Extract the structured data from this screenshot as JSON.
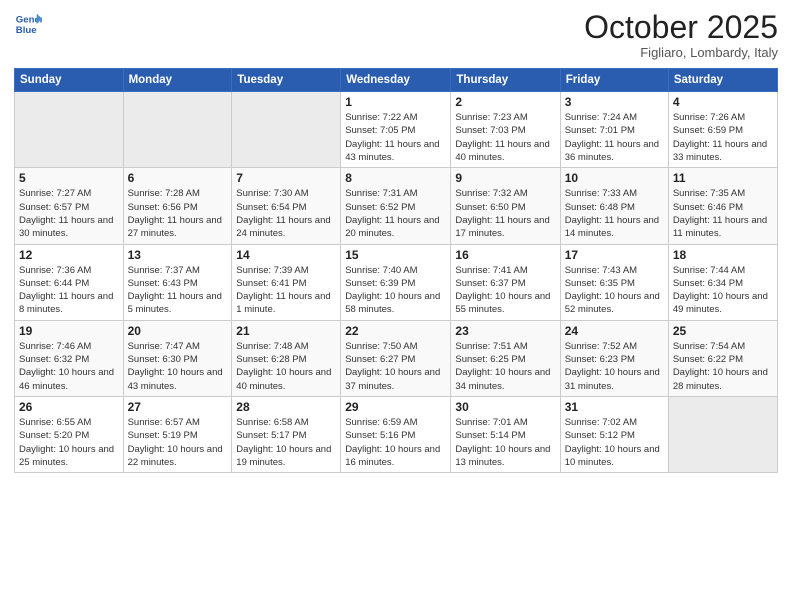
{
  "header": {
    "logo_line1": "General",
    "logo_line2": "Blue",
    "month": "October 2025",
    "location": "Figliaro, Lombardy, Italy"
  },
  "weekdays": [
    "Sunday",
    "Monday",
    "Tuesday",
    "Wednesday",
    "Thursday",
    "Friday",
    "Saturday"
  ],
  "weeks": [
    [
      {
        "day": "",
        "sunrise": "",
        "sunset": "",
        "daylight": ""
      },
      {
        "day": "",
        "sunrise": "",
        "sunset": "",
        "daylight": ""
      },
      {
        "day": "",
        "sunrise": "",
        "sunset": "",
        "daylight": ""
      },
      {
        "day": "1",
        "sunrise": "Sunrise: 7:22 AM",
        "sunset": "Sunset: 7:05 PM",
        "daylight": "Daylight: 11 hours and 43 minutes."
      },
      {
        "day": "2",
        "sunrise": "Sunrise: 7:23 AM",
        "sunset": "Sunset: 7:03 PM",
        "daylight": "Daylight: 11 hours and 40 minutes."
      },
      {
        "day": "3",
        "sunrise": "Sunrise: 7:24 AM",
        "sunset": "Sunset: 7:01 PM",
        "daylight": "Daylight: 11 hours and 36 minutes."
      },
      {
        "day": "4",
        "sunrise": "Sunrise: 7:26 AM",
        "sunset": "Sunset: 6:59 PM",
        "daylight": "Daylight: 11 hours and 33 minutes."
      }
    ],
    [
      {
        "day": "5",
        "sunrise": "Sunrise: 7:27 AM",
        "sunset": "Sunset: 6:57 PM",
        "daylight": "Daylight: 11 hours and 30 minutes."
      },
      {
        "day": "6",
        "sunrise": "Sunrise: 7:28 AM",
        "sunset": "Sunset: 6:56 PM",
        "daylight": "Daylight: 11 hours and 27 minutes."
      },
      {
        "day": "7",
        "sunrise": "Sunrise: 7:30 AM",
        "sunset": "Sunset: 6:54 PM",
        "daylight": "Daylight: 11 hours and 24 minutes."
      },
      {
        "day": "8",
        "sunrise": "Sunrise: 7:31 AM",
        "sunset": "Sunset: 6:52 PM",
        "daylight": "Daylight: 11 hours and 20 minutes."
      },
      {
        "day": "9",
        "sunrise": "Sunrise: 7:32 AM",
        "sunset": "Sunset: 6:50 PM",
        "daylight": "Daylight: 11 hours and 17 minutes."
      },
      {
        "day": "10",
        "sunrise": "Sunrise: 7:33 AM",
        "sunset": "Sunset: 6:48 PM",
        "daylight": "Daylight: 11 hours and 14 minutes."
      },
      {
        "day": "11",
        "sunrise": "Sunrise: 7:35 AM",
        "sunset": "Sunset: 6:46 PM",
        "daylight": "Daylight: 11 hours and 11 minutes."
      }
    ],
    [
      {
        "day": "12",
        "sunrise": "Sunrise: 7:36 AM",
        "sunset": "Sunset: 6:44 PM",
        "daylight": "Daylight: 11 hours and 8 minutes."
      },
      {
        "day": "13",
        "sunrise": "Sunrise: 7:37 AM",
        "sunset": "Sunset: 6:43 PM",
        "daylight": "Daylight: 11 hours and 5 minutes."
      },
      {
        "day": "14",
        "sunrise": "Sunrise: 7:39 AM",
        "sunset": "Sunset: 6:41 PM",
        "daylight": "Daylight: 11 hours and 1 minute."
      },
      {
        "day": "15",
        "sunrise": "Sunrise: 7:40 AM",
        "sunset": "Sunset: 6:39 PM",
        "daylight": "Daylight: 10 hours and 58 minutes."
      },
      {
        "day": "16",
        "sunrise": "Sunrise: 7:41 AM",
        "sunset": "Sunset: 6:37 PM",
        "daylight": "Daylight: 10 hours and 55 minutes."
      },
      {
        "day": "17",
        "sunrise": "Sunrise: 7:43 AM",
        "sunset": "Sunset: 6:35 PM",
        "daylight": "Daylight: 10 hours and 52 minutes."
      },
      {
        "day": "18",
        "sunrise": "Sunrise: 7:44 AM",
        "sunset": "Sunset: 6:34 PM",
        "daylight": "Daylight: 10 hours and 49 minutes."
      }
    ],
    [
      {
        "day": "19",
        "sunrise": "Sunrise: 7:46 AM",
        "sunset": "Sunset: 6:32 PM",
        "daylight": "Daylight: 10 hours and 46 minutes."
      },
      {
        "day": "20",
        "sunrise": "Sunrise: 7:47 AM",
        "sunset": "Sunset: 6:30 PM",
        "daylight": "Daylight: 10 hours and 43 minutes."
      },
      {
        "day": "21",
        "sunrise": "Sunrise: 7:48 AM",
        "sunset": "Sunset: 6:28 PM",
        "daylight": "Daylight: 10 hours and 40 minutes."
      },
      {
        "day": "22",
        "sunrise": "Sunrise: 7:50 AM",
        "sunset": "Sunset: 6:27 PM",
        "daylight": "Daylight: 10 hours and 37 minutes."
      },
      {
        "day": "23",
        "sunrise": "Sunrise: 7:51 AM",
        "sunset": "Sunset: 6:25 PM",
        "daylight": "Daylight: 10 hours and 34 minutes."
      },
      {
        "day": "24",
        "sunrise": "Sunrise: 7:52 AM",
        "sunset": "Sunset: 6:23 PM",
        "daylight": "Daylight: 10 hours and 31 minutes."
      },
      {
        "day": "25",
        "sunrise": "Sunrise: 7:54 AM",
        "sunset": "Sunset: 6:22 PM",
        "daylight": "Daylight: 10 hours and 28 minutes."
      }
    ],
    [
      {
        "day": "26",
        "sunrise": "Sunrise: 6:55 AM",
        "sunset": "Sunset: 5:20 PM",
        "daylight": "Daylight: 10 hours and 25 minutes."
      },
      {
        "day": "27",
        "sunrise": "Sunrise: 6:57 AM",
        "sunset": "Sunset: 5:19 PM",
        "daylight": "Daylight: 10 hours and 22 minutes."
      },
      {
        "day": "28",
        "sunrise": "Sunrise: 6:58 AM",
        "sunset": "Sunset: 5:17 PM",
        "daylight": "Daylight: 10 hours and 19 minutes."
      },
      {
        "day": "29",
        "sunrise": "Sunrise: 6:59 AM",
        "sunset": "Sunset: 5:16 PM",
        "daylight": "Daylight: 10 hours and 16 minutes."
      },
      {
        "day": "30",
        "sunrise": "Sunrise: 7:01 AM",
        "sunset": "Sunset: 5:14 PM",
        "daylight": "Daylight: 10 hours and 13 minutes."
      },
      {
        "day": "31",
        "sunrise": "Sunrise: 7:02 AM",
        "sunset": "Sunset: 5:12 PM",
        "daylight": "Daylight: 10 hours and 10 minutes."
      },
      {
        "day": "",
        "sunrise": "",
        "sunset": "",
        "daylight": ""
      }
    ]
  ]
}
